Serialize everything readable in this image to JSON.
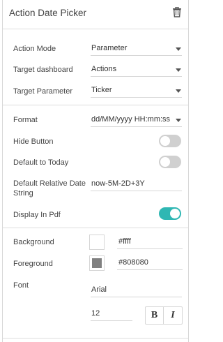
{
  "panel": {
    "title": "Action Date Picker",
    "delete_icon": "trash-icon"
  },
  "action": {
    "mode_label": "Action Mode",
    "mode_value": "Parameter",
    "target_dashboard_label": "Target dashboard",
    "target_dashboard_value": "Actions",
    "target_parameter_label": "Target Parameter",
    "target_parameter_value": "Ticker"
  },
  "date": {
    "format_label": "Format",
    "format_value": "dd/MM/yyyy HH:mm:ss",
    "hide_button_label": "Hide Button",
    "hide_button_on": false,
    "default_today_label": "Default to Today",
    "default_today_on": false,
    "relative_label_line1": "Default Relative Date",
    "relative_label_line2": "String",
    "relative_value": "now-5M-2D+3Y",
    "display_pdf_label": "Display In Pdf",
    "display_pdf_on": true
  },
  "style": {
    "background_label": "Background",
    "background_value": "#ffff",
    "background_color": "#ffffff",
    "foreground_label": "Foreground",
    "foreground_value": "#808080",
    "foreground_color": "#808080",
    "font_label": "Font",
    "font_value": "Arial",
    "font_size": "12",
    "bold_label": "B",
    "italic_label": "I"
  },
  "colors": {
    "accent": "#2fb7b3",
    "toggle_off": "#d0d0d0"
  }
}
